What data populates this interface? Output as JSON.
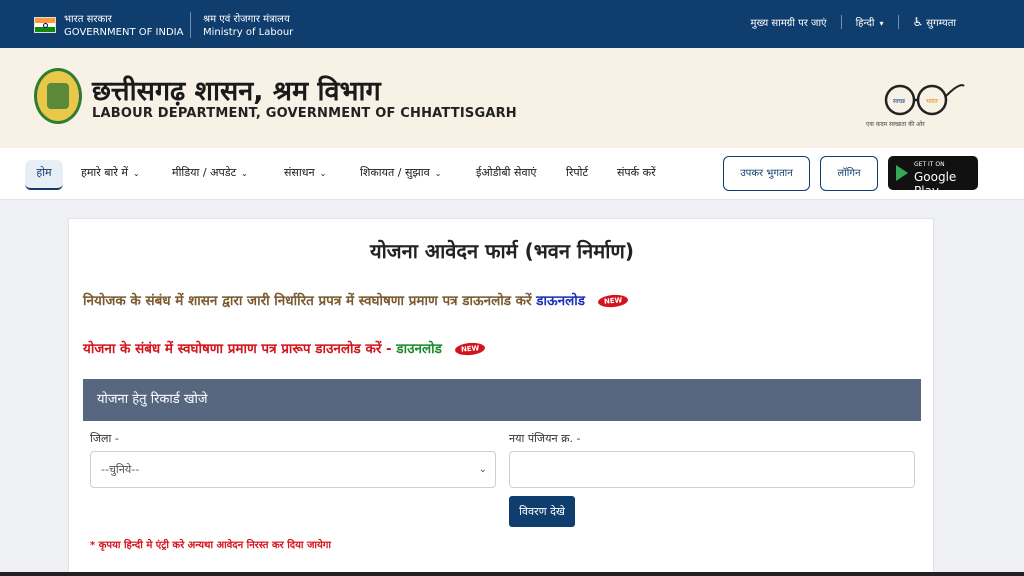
{
  "gov_bar": {
    "hindi_line": "भारत सरकार",
    "english_line": "GOVERNMENT OF INDIA",
    "ministry_hindi": "श्रम एवं रोजगार मंत्रालय",
    "ministry_english": "Ministry of Labour",
    "skip_link": "मुख्य सामग्री पर जाएं",
    "language": "हिन्दी",
    "accessibility": "सुगम्यता"
  },
  "header": {
    "title_hindi": "छत्तीसगढ़ शासन, श्रम विभाग",
    "title_english": "LABOUR DEPARTMENT, GOVERNMENT OF CHHATTISGARH",
    "swachh_label": "स्वच्छ भारत",
    "swachh_tagline": "एक कदम स्वच्छता की ओर"
  },
  "nav": {
    "home": "होम",
    "items": [
      {
        "label": "हमारे बारे में"
      },
      {
        "label": "मीडिया / अपडेट"
      },
      {
        "label": "संसाधन"
      },
      {
        "label": "शिकायत / सुझाव"
      },
      {
        "label": "ईओडीबी सेवाएं"
      },
      {
        "label": "रिपोर्ट"
      },
      {
        "label": "संपर्क करें"
      }
    ],
    "cess_button": "उपकर भुगतान",
    "login_button": "लॉगिन",
    "gplay_small": "GET IT ON",
    "gplay_big": "Google Play"
  },
  "form": {
    "title": "योजना आवेदन फार्म (भवन निर्माण)",
    "line1_text": "नियोजक के संबंध में शासन द्वारा जारी निर्धारित प्रपत्र में स्वघोषणा प्रमाण पत्र डाऊनलोड करें",
    "line1_link": "डाऊनलोड",
    "line2_text": "योजना के संबंध में स्वघोषणा प्रमाण पत्र प्रारूप डाउनलोड करें -",
    "line2_link": "डाउनलोड",
    "new_badge": "NEW",
    "panel_heading": "योजना हेतु रिकार्ड खोजे",
    "district_label": "जिला -",
    "district_selected": "--चुनिये--",
    "registration_label": "नया पंजियन क्र. -",
    "registration_value": "",
    "view_button": "विवरण देखे",
    "note": "* कृपया हिन्दी मे एंट्री करे अन्यथा आवेदन निरस्त कर दिया जायेगा"
  },
  "colors": {
    "gov_bar": "#0f3d6e",
    "header_bg": "#f7f1e6",
    "panel_head": "#56677f",
    "red": "#d4141c",
    "green": "#1d8a2e",
    "blue_link": "#1a2fb8"
  }
}
